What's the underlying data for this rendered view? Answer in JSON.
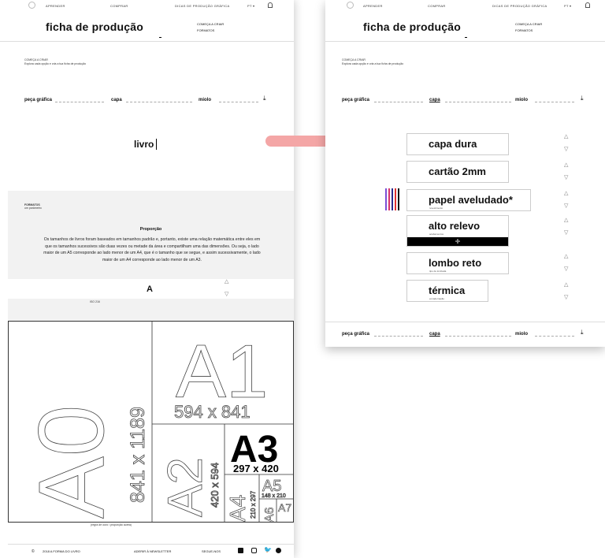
{
  "nav": {
    "items": [
      "APRENDER",
      "COMPRAR",
      "DICAS DE PRODUÇÃO GRÁFICA"
    ],
    "lang": "PT ▾"
  },
  "left": {
    "title": "ficha de produção",
    "submenu": [
      "COMEÇA A CRIAR",
      "FORMATOS"
    ],
    "intro_heading": "COMEÇA A CRIAR",
    "intro_text": "Explora cada opção e cria a tua ficha de produção",
    "tabs": [
      "peça gráfica",
      "capa",
      "miolo"
    ],
    "selected": "livro",
    "formats_label": "FORMATOS",
    "formats_sub": "um parâmetro",
    "section_title": "Proporção",
    "paragraph": "Os tamanhos de livros foram baseados em tamanhos padrão e, portanto, existe uma relação matemática entre eles em que os tamanhos sucessivos são duas vezes ou metade da área e compartilham uma das dimensões. Ou seja, o lado maior de um A5 corresponde ao lado menor de um A4, que é o tamanho que se segue, e assim sucessivamente, o lado maior de um A4 corresponde ao lado menor de um A3.",
    "format_letter": "A",
    "iso_label": "ISO 216",
    "caption": "(regra de ouro / proporção áurea)",
    "paper": {
      "a0_big": "A0",
      "a0_dim": "841 x 1189",
      "a1_big": "A1",
      "a1_dim": "594 x 841",
      "a2_big": "A2",
      "a2_dim": "420 x 594",
      "a3_big": "A3",
      "a3_dim": "297 x 420",
      "a4_big": "A4",
      "a4_dim": "210 x 297",
      "a5_big": "A5",
      "a5_dim": "148 x 210",
      "a6_big": "A6",
      "a7_big": "A7"
    },
    "footer": {
      "copy": "©",
      "brand": "2018 A FORMA DO LIVRO",
      "newsletter": "ADERIR À NEWSLETTER",
      "follow": "SEGUE-NOS"
    }
  },
  "right": {
    "title": "ficha de produção",
    "submenu": [
      "COMEÇA A CRIAR",
      "FORMATOS"
    ],
    "intro_heading": "COMEÇA A CRIAR",
    "intro_text": "Explora cada opção e cria a tua ficha de produção",
    "tabs": [
      "peça gráfica",
      "capa",
      "miolo"
    ],
    "options": [
      {
        "label": "capa dura",
        "caption": ""
      },
      {
        "label": "cartão 2mm",
        "caption": ""
      },
      {
        "label": "papel aveludado*",
        "caption": "revestimento"
      },
      {
        "label": "alto relevo",
        "caption": "acabamentos"
      },
      {
        "label": "lombo reto",
        "caption": "tipo de lombada"
      },
      {
        "label": "térmica",
        "caption": "encadernação"
      }
    ],
    "add_symbol": "✛",
    "swatch_colors": [
      "#7b4fd6",
      "#d6336c",
      "#2b2b8c",
      "#e03131",
      "#111111"
    ]
  },
  "accent": "#f4a6a6"
}
